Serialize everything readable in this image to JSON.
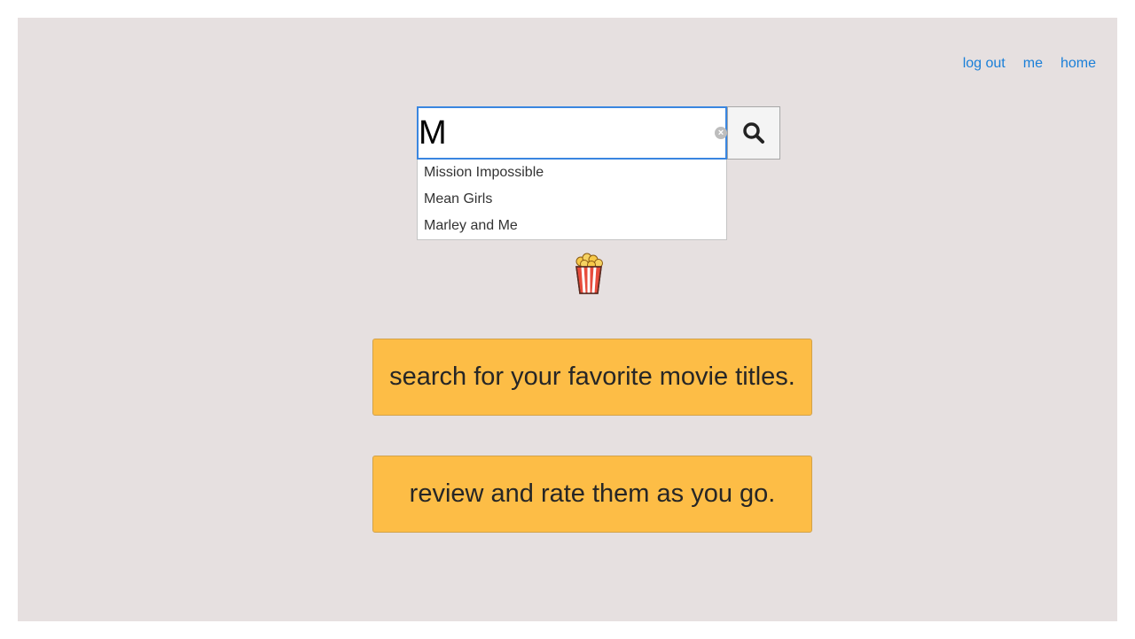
{
  "nav": {
    "items": [
      {
        "label": "log out"
      },
      {
        "label": "me"
      },
      {
        "label": "home"
      }
    ]
  },
  "search": {
    "value": "M",
    "placeholder": "",
    "clear_icon": "clear-circle-icon",
    "button_icon": "search-icon"
  },
  "suggestions": [
    {
      "label": "Mission Impossible"
    },
    {
      "label": "Mean Girls"
    },
    {
      "label": "Marley and Me"
    }
  ],
  "logo": {
    "icon": "popcorn-icon"
  },
  "cards": [
    {
      "text": "search for your favorite movie titles."
    },
    {
      "text": "review and rate them as you go."
    }
  ],
  "colors": {
    "background": "#e6e0e0",
    "link": "#1a7fd8",
    "card": "#fdbd46",
    "input_focus_border": "#3a86e0"
  }
}
